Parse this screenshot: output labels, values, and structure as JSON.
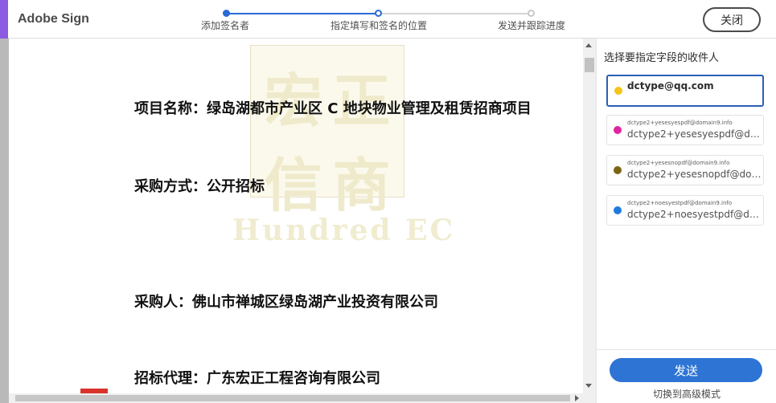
{
  "app": {
    "brand": "Adobe Sign"
  },
  "steps": [
    {
      "label": "添加签名者",
      "state": "done"
    },
    {
      "label": "指定填写和签名的位置",
      "state": "current"
    },
    {
      "label": "发送并跟踪进度",
      "state": "pending"
    }
  ],
  "header": {
    "close_label": "关闭"
  },
  "document": {
    "lines": [
      "项目名称：绿岛湖都市产业区 C 地块物业管理及租赁招商项目",
      "采购方式：公开招标",
      "采购人：佛山市禅城区绿岛湖产业投资有限公司",
      "招标代理：广东宏正工程咨询有限公司"
    ],
    "watermark": {
      "seal_glyphs": [
        "宏",
        "正",
        "信",
        "商"
      ],
      "text": "Hundred EC"
    }
  },
  "panel": {
    "title": "选择要指定字段的收件人",
    "recipients": [
      {
        "main": "dctype@qq.com",
        "color": "#f5c518",
        "active": true
      },
      {
        "small": "dctype2+yesesyespdf@domain9.info",
        "big": "dctype2+yesesyespdf@domain9.info",
        "color": "#e0269f",
        "active": false
      },
      {
        "small": "dctype2+yesesnopdf@domain9.info",
        "big": "dctype2+yesesnopdf@domain9.info",
        "color": "#7c6414",
        "active": false
      },
      {
        "small": "dctype2+noesyestpdf@domain9.info",
        "big": "dctype2+noesyestpdf@domain9.info",
        "color": "#1f7ae0",
        "active": false
      }
    ],
    "send_label": "发送",
    "advanced_label": "切换到高级模式"
  },
  "colors": {
    "accent": "#2d74d4",
    "brand": "#8c5be2",
    "active_border": "#2b5fb4"
  }
}
